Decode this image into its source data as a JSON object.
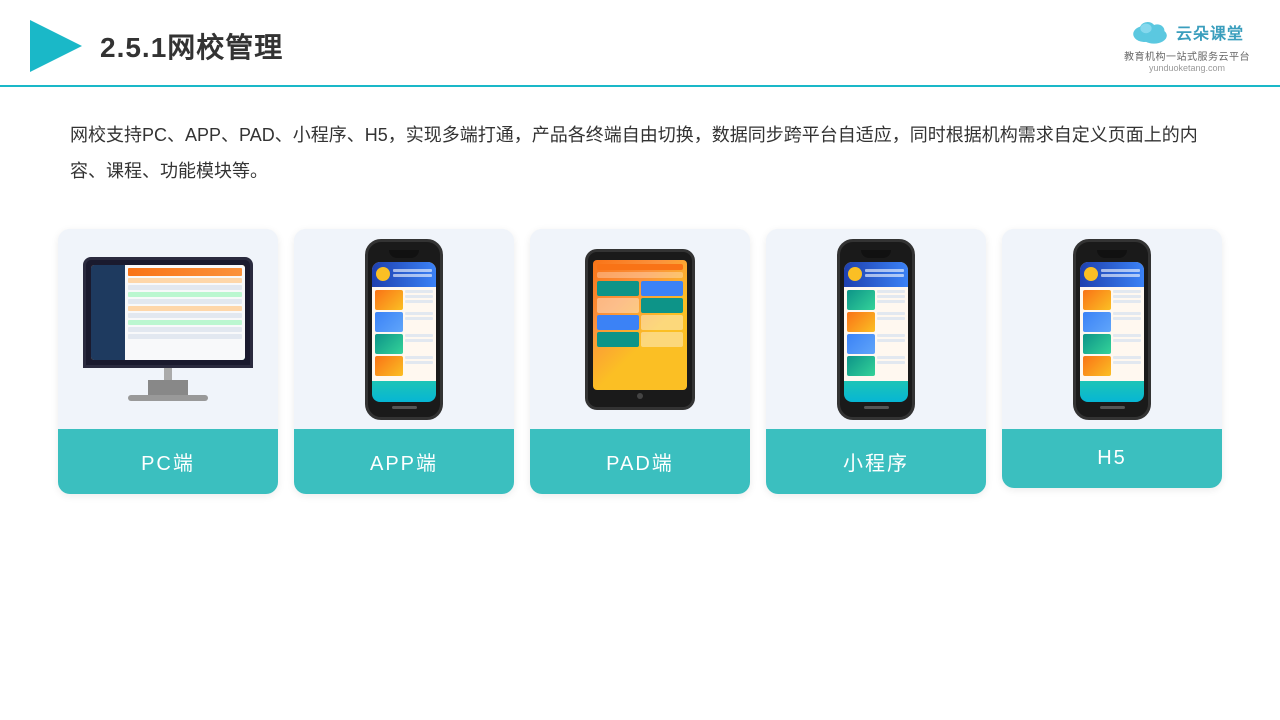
{
  "header": {
    "title": "2.5.1网校管理",
    "logo": {
      "name": "云朵课堂",
      "url": "yunduoketang.com",
      "tagline": "教育机构一站\n式服务云平台"
    }
  },
  "description": "网校支持PC、APP、PAD、小程序、H5，实现多端打通，产品各终端自由切换，数据同步跨平台自适应，同时根据机构需求自定义页面上的内容、课程、功能模块等。",
  "cards": [
    {
      "id": "pc",
      "label": "PC端"
    },
    {
      "id": "app",
      "label": "APP端"
    },
    {
      "id": "pad",
      "label": "PAD端"
    },
    {
      "id": "miniprogram",
      "label": "小程序"
    },
    {
      "id": "h5",
      "label": "H5"
    }
  ],
  "accent_color": "#3bbfbf"
}
